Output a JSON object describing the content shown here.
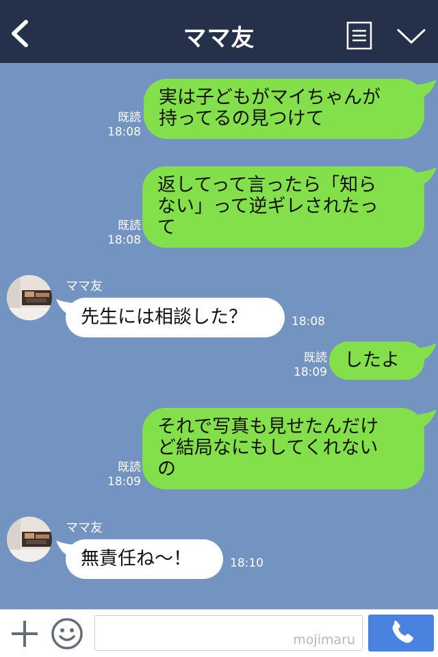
{
  "header": {
    "title": "ママ友",
    "back_icon": "chevron-left-icon",
    "menu_icon": "list-menu-icon",
    "collapse_icon": "chevron-down-icon"
  },
  "messages": [
    {
      "side": "out",
      "lines": [
        "実は子どもがマイちゃんが",
        "持ってるの見つけて"
      ],
      "read": "既読",
      "time": "18:08"
    },
    {
      "side": "out",
      "lines": [
        "返してって言ったら「知ら",
        "ない」って逆ギレされたっ",
        "て"
      ],
      "read": "既読",
      "time": "18:08"
    },
    {
      "side": "in",
      "sender": "ママ友",
      "text": "先生には相談した？",
      "time": "18:08"
    },
    {
      "side": "out",
      "lines": [
        "したよ"
      ],
      "read": "既読",
      "time": "18:09"
    },
    {
      "side": "out",
      "lines": [
        "それで写真も見せたんだけ",
        "ど結局なにもしてくれない",
        "の"
      ],
      "read": "既読",
      "time": "18:09"
    },
    {
      "side": "in",
      "sender": "ママ友",
      "text": "無責任ね〜！",
      "time": "18:10"
    }
  ],
  "footer": {
    "watermark": "mojimaru",
    "plus_icon": "plus-icon",
    "emoji_icon": "smiley-icon",
    "send_icon": "phone-icon"
  },
  "colors": {
    "header_bg": "#25304a",
    "chat_bg": "#7393c1",
    "outgoing_bubble": "#84e04a",
    "incoming_bubble": "#ffffff",
    "send_button": "#4a82e0"
  }
}
